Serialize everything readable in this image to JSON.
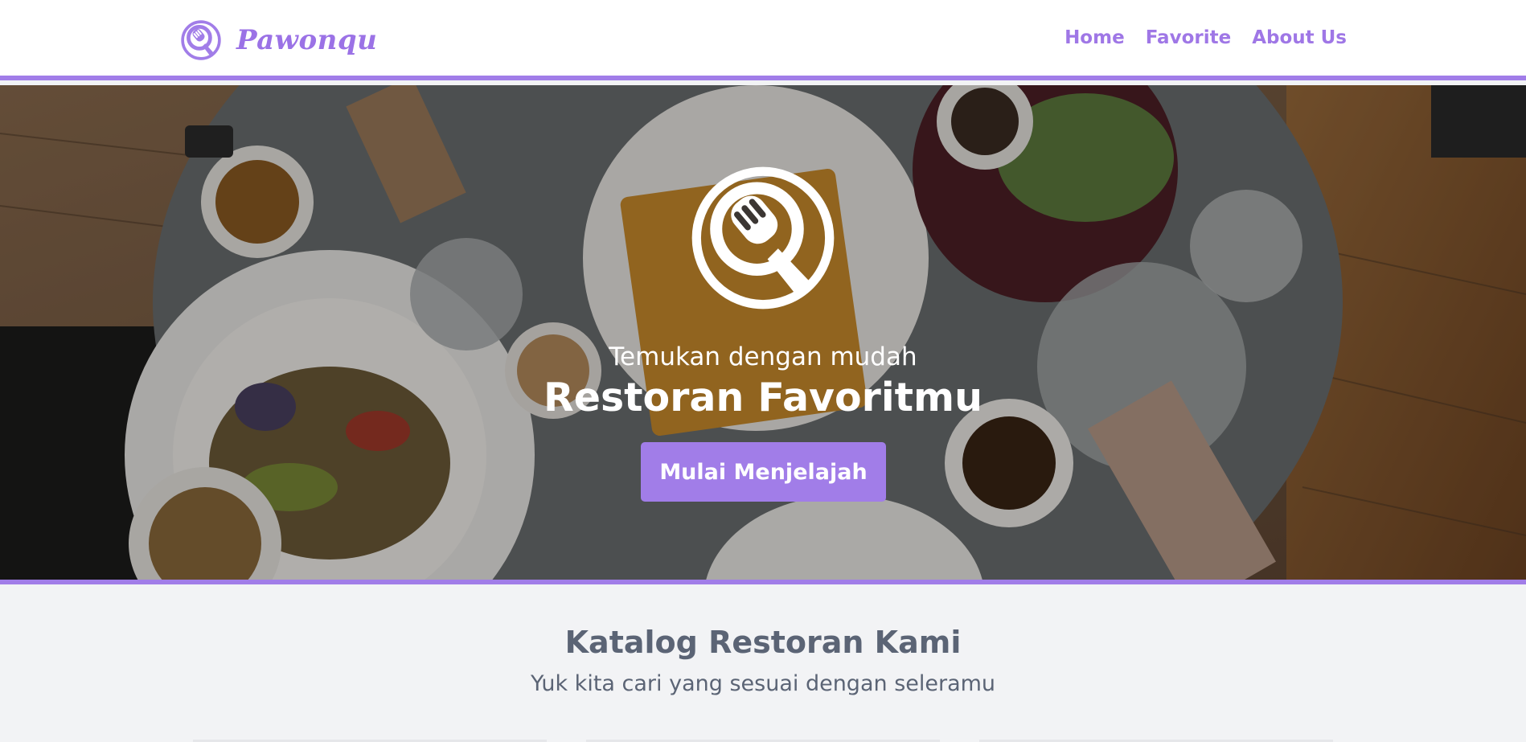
{
  "header": {
    "brand_name": "Pawonqu",
    "nav": [
      {
        "label": "Home"
      },
      {
        "label": "Favorite"
      },
      {
        "label": "About Us"
      }
    ]
  },
  "hero": {
    "tagline": "Temukan dengan mudah",
    "title": "Restoran Favoritmu",
    "cta_label": "Mulai Menjelajah"
  },
  "catalog": {
    "title": "Katalog Restoran Kami",
    "subtitle": "Yuk kita cari yang sesuai dengan seleramu"
  },
  "colors": {
    "accent": "#a17de8",
    "text_muted": "#5b6475",
    "page_bg": "#f2f3f5"
  },
  "icons": {
    "brand_logo": "fork-circle-icon",
    "hero_logo": "fork-circle-icon"
  }
}
